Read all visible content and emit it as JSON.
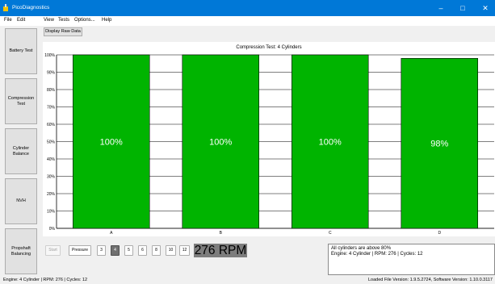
{
  "window": {
    "title": "PicoDiagnostics",
    "minimize": "–",
    "maximize": "□",
    "close": "✕"
  },
  "menu": {
    "items": [
      "File",
      "Edit",
      "View",
      "Tests",
      "Options...",
      "Help"
    ]
  },
  "toolbar": {
    "display_raw": "Display Raw Data"
  },
  "sidebar": {
    "items": [
      "Battery Test",
      "Compression Test",
      "Cylinder Balance",
      "NVH",
      "Propshaft Balancing"
    ]
  },
  "chart_data": {
    "type": "bar",
    "title": "Compression Test: 4 Cylinders",
    "categories": [
      "A",
      "B",
      "C",
      "D"
    ],
    "values": [
      100,
      100,
      100,
      98
    ],
    "value_labels": [
      "100%",
      "100%",
      "100%",
      "98%"
    ],
    "yticks": [
      "0%",
      "10%",
      "20%",
      "30%",
      "40%",
      "50%",
      "60%",
      "70%",
      "80%",
      "90%",
      "100%"
    ],
    "ylim": [
      0,
      100
    ],
    "bar_color": "#00b400",
    "grid": true
  },
  "controls": {
    "start": "Start",
    "pressure": "Pressure",
    "cycles": [
      "3",
      "4",
      "5",
      "6",
      "8",
      "10",
      "12"
    ],
    "selected_cycle": "4",
    "rpm": "276 RPM"
  },
  "message": {
    "line1": "All cylinders are above 80%",
    "line2": "Engine: 4 Cylinder | RPM: 276 | Cycles: 12"
  },
  "status": {
    "left": "Engine: 4 Cylinder | RPM: 276 | Cycles: 12",
    "right": "Loaded File Version: 1.9.5.2724,  Software Version: 1.10.0.3117"
  },
  "colors": {
    "titlebar": "#0078d7",
    "bar": "#00b400"
  }
}
